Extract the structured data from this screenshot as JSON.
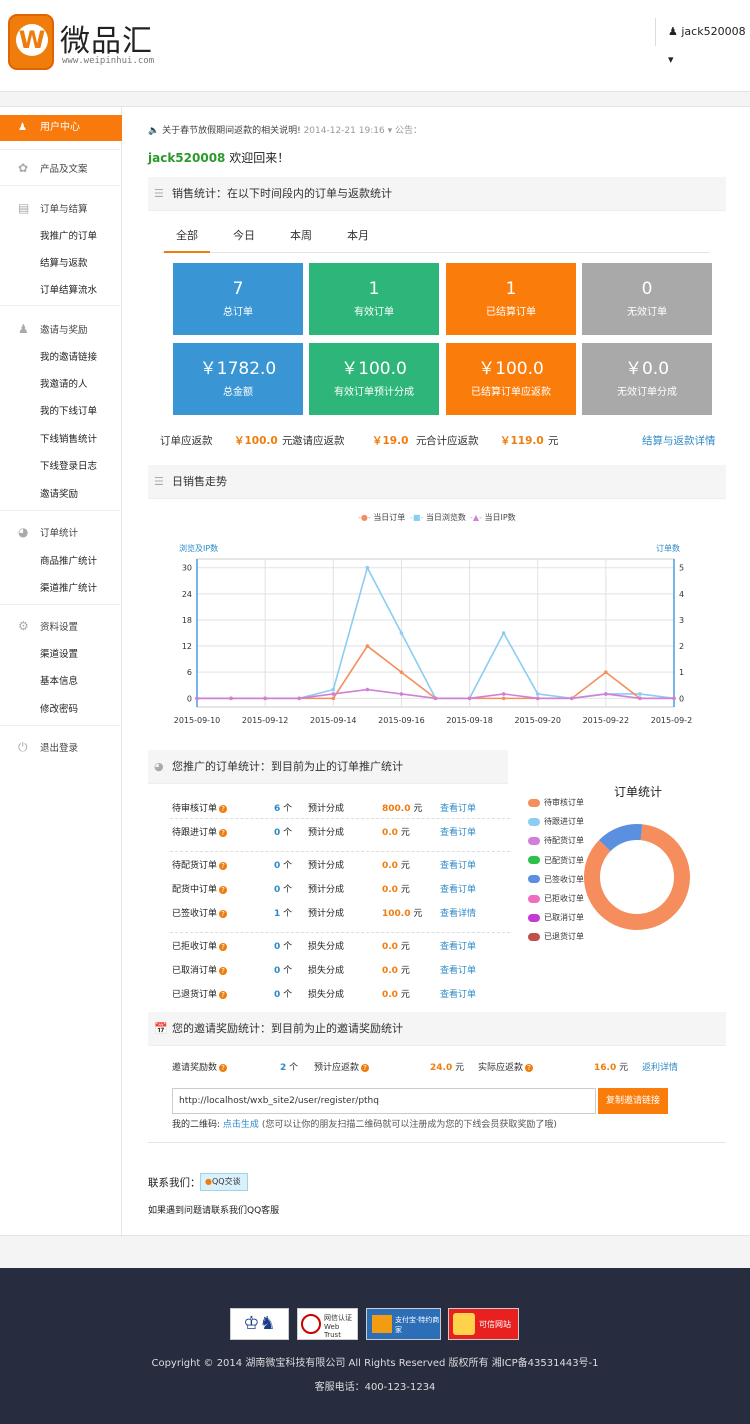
{
  "header": {
    "logo_letter": "W",
    "brand": "微品汇",
    "brand_url": "www.weipinhui.com",
    "username": "jack520008",
    "user_caret": "▾"
  },
  "sidebar": {
    "active": "用户中心",
    "groups": [
      {
        "label": "产品及文案",
        "icon": "products-icon",
        "items": []
      },
      {
        "label": "订单与结算",
        "icon": "document-icon",
        "items": [
          "我推广的订单",
          "结算与返款",
          "订单结算流水"
        ]
      },
      {
        "label": "邀请与奖励",
        "icon": "users-icon",
        "items": [
          "我的邀请链接",
          "我邀请的人",
          "我的下线订单",
          "下线销售统计",
          "下线登录日志",
          "邀请奖励"
        ]
      },
      {
        "label": "订单统计",
        "icon": "pie-icon",
        "items": [
          "商品推广统计",
          "渠道推广统计"
        ]
      },
      {
        "label": "资料设置",
        "icon": "gear-icon",
        "items": [
          "渠道设置",
          "基本信息",
          "修改密码"
        ]
      },
      {
        "label": "退出登录",
        "icon": "power-icon",
        "items": []
      }
    ]
  },
  "notice": {
    "text": "关于春节放假期间返款的相关说明!",
    "date": "2014-12-21 19:16",
    "label": "公告："
  },
  "welcome": {
    "user": "jack520008",
    "text": "欢迎回来！"
  },
  "sales": {
    "title": "销售统计：在以下时间段内的订单与返款统计",
    "tabs": [
      "全部",
      "今日",
      "本周",
      "本月"
    ],
    "cards": [
      {
        "value": "7",
        "label": "总订单",
        "color": "blue"
      },
      {
        "value": "1",
        "label": "有效订单",
        "color": "green"
      },
      {
        "value": "1",
        "label": "已结算订单",
        "color": "orange"
      },
      {
        "value": "0",
        "label": "无效订单",
        "color": "gray"
      },
      {
        "value": "￥1782.0",
        "label": "总金额",
        "color": "blue"
      },
      {
        "value": "￥100.0",
        "label": "有效订单预计分成",
        "color": "green"
      },
      {
        "value": "￥100.0",
        "label": "已结算订单应返款",
        "color": "orange"
      },
      {
        "value": "￥0.0",
        "label": "无效订单分成",
        "color": "gray"
      }
    ],
    "summary": {
      "order_refund_label": "订单应返款",
      "order_refund_value": "￥100.0",
      "unit": "元",
      "invite_refund_label": "邀请应返款",
      "invite_refund_value": "￥19.0",
      "total_refund_label": "合计应返款",
      "total_refund_value": "￥119.0",
      "details_link": "结算与返款详情"
    }
  },
  "daily": {
    "title": "日销售走势",
    "legend": [
      "当日订单",
      "当日浏览数",
      "当日IP数"
    ]
  },
  "chart_data": {
    "type": "line",
    "x": [
      "2015-09-10",
      "2015-09-11",
      "2015-09-12",
      "2015-09-13",
      "2015-09-14",
      "2015-09-15",
      "2015-09-16",
      "2015-09-17",
      "2015-09-18",
      "2015-09-19",
      "2015-09-20",
      "2015-09-21",
      "2015-09-22",
      "2015-09-23",
      "2015-09-24"
    ],
    "xticks": [
      "2015-09-10",
      "2015-09-12",
      "2015-09-14",
      "2015-09-16",
      "2015-09-18",
      "2015-09-20",
      "2015-09-22",
      "2015-09-24"
    ],
    "ylabel_left": "浏览及IP数",
    "ylabel_right": "订单数",
    "yticks_left": [
      0,
      6,
      12,
      18,
      24,
      30
    ],
    "yticks_right": [
      0,
      1,
      2,
      3,
      4,
      5
    ],
    "ylim_left": [
      -2,
      32
    ],
    "ylim_right": [
      -0.33,
      5.33
    ],
    "series": [
      {
        "name": "当日订单",
        "axis": "right",
        "color": "#f58d5c",
        "values": [
          0,
          0,
          0,
          0,
          0,
          2,
          1,
          0,
          0,
          0,
          0,
          0,
          1,
          0,
          0
        ]
      },
      {
        "name": "当日浏览数",
        "axis": "left",
        "color": "#8ccdf2",
        "values": [
          0,
          0,
          0,
          0,
          2,
          30,
          15,
          0,
          0,
          15,
          1,
          0,
          1,
          1,
          0
        ]
      },
      {
        "name": "当日IP数",
        "axis": "left",
        "color": "#d17fd9",
        "values": [
          0,
          0,
          0,
          0,
          1,
          2,
          1,
          0,
          0,
          1,
          0,
          0,
          1,
          0,
          0
        ]
      }
    ],
    "grid": true,
    "legend_position": "top"
  },
  "order_stats": {
    "title": "您推广的订单统计：到目前为止的订单推广统计",
    "rows": [
      {
        "label": "待审核订单",
        "count": "6",
        "unit": "个",
        "kind": "预计分成",
        "amount": "800.0",
        "currency": "元",
        "link": "查看订单"
      },
      {
        "label": "待跟进订单",
        "count": "0",
        "unit": "个",
        "kind": "预计分成",
        "amount": "0.0",
        "currency": "元",
        "link": "查看订单"
      },
      {
        "label": "待配货订单",
        "count": "0",
        "unit": "个",
        "kind": "预计分成",
        "amount": "0.0",
        "currency": "元",
        "link": "查看订单"
      },
      {
        "label": "配货中订单",
        "count": "0",
        "unit": "个",
        "kind": "预计分成",
        "amount": "0.0",
        "currency": "元",
        "link": "查看订单"
      },
      {
        "label": "已签收订单",
        "count": "1",
        "unit": "个",
        "kind": "预计分成",
        "amount": "100.0",
        "currency": "元",
        "link": "查看详情"
      },
      {
        "label": "已拒收订单",
        "count": "0",
        "unit": "个",
        "kind": "损失分成",
        "amount": "0.0",
        "currency": "元",
        "link": "查看订单"
      },
      {
        "label": "已取消订单",
        "count": "0",
        "unit": "个",
        "kind": "损失分成",
        "amount": "0.0",
        "currency": "元",
        "link": "查看订单"
      },
      {
        "label": "已退货订单",
        "count": "0",
        "unit": "个",
        "kind": "损失分成",
        "amount": "0.0",
        "currency": "元",
        "link": "查看订单"
      }
    ],
    "pie_title": "订单统计",
    "pie_legend": [
      {
        "label": "待审核订单",
        "color": "#f58d5c"
      },
      {
        "label": "待跟进订单",
        "color": "#8ccdf2"
      },
      {
        "label": "待配货订单",
        "color": "#d17fd9"
      },
      {
        "label": "已配货订单",
        "color": "#2cc24a"
      },
      {
        "label": "已签收订单",
        "color": "#5b8fe0"
      },
      {
        "label": "已拒收订单",
        "color": "#ef6fbf"
      },
      {
        "label": "已取消订单",
        "color": "#c43bd4"
      },
      {
        "label": "已退货订单",
        "color": "#c0504d"
      }
    ],
    "pie_values": [
      6,
      0,
      0,
      0,
      1,
      0,
      0,
      0
    ]
  },
  "invite": {
    "title": "您的邀请奖励统计：到目前为止的邀请奖励统计",
    "count_label": "邀请奖励数",
    "count": "2",
    "count_unit": "个",
    "expected_label": "预计应返款",
    "expected": "24.0",
    "actual_label": "实际应返款",
    "actual": "16.0",
    "currency": "元",
    "details_link": "返利详情",
    "link_url": "http://localhost/wxb_site2/user/register/pthq",
    "copy_button": "复制邀请链接",
    "qr_label": "我的二维码:",
    "qr_link": "点击生成",
    "qr_note": "(您可以让你的朋友扫描二维码就可以注册成为您的下线会员获取奖励了哦)"
  },
  "contact": {
    "label": "联系我们：",
    "qq_button": "QQ交谈",
    "note": "如果遇到问题请联系我们QQ客服"
  },
  "footer": {
    "badges": [
      {
        "text": "",
        "icon": "police-badge-icon"
      },
      {
        "text": "网信认证 Web Trust",
        "icon": "webtrust-icon"
      },
      {
        "text": "支付宝·特约商家",
        "icon": "alipay-icon"
      },
      {
        "text": "可信网站",
        "icon": "trusted-site-icon"
      }
    ],
    "copyright": "Copyright © 2014 湖南微宝科技有限公司 All Rights Reserved 版权所有 湘ICP备43531443号-1",
    "service_phone": "客服电话：400-123-1234"
  }
}
